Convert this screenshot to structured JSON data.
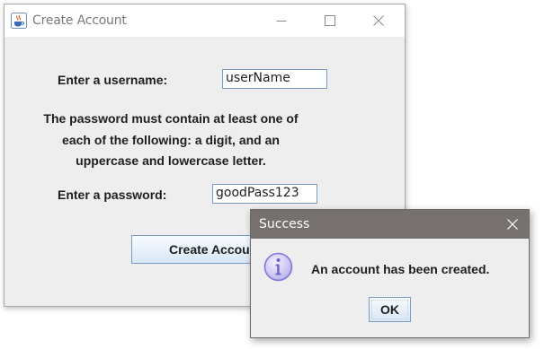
{
  "main_window": {
    "title": "Create Account",
    "icon": "java-cup-icon",
    "controls": {
      "minimize": "minimize-icon",
      "maximize": "maximize-icon",
      "close": "close-icon"
    },
    "username_label": "Enter a username:",
    "username_value": "userName",
    "password_notice": [
      "The password must contain at least one of",
      "each of the following: a digit, and an",
      "uppercase and lowercase letter."
    ],
    "password_label": "Enter a password:",
    "password_value": "goodPass123",
    "create_button": "Create Account"
  },
  "dialog": {
    "title": "Success",
    "close": "close-icon",
    "icon": "info-icon",
    "message": "An account has been created.",
    "ok_button": "OK"
  },
  "colors": {
    "window_bg": "#eeeeee",
    "dialog_title_bg": "#76716e",
    "button_border": "#7a9cc2",
    "info_icon": "#7f78d9"
  }
}
